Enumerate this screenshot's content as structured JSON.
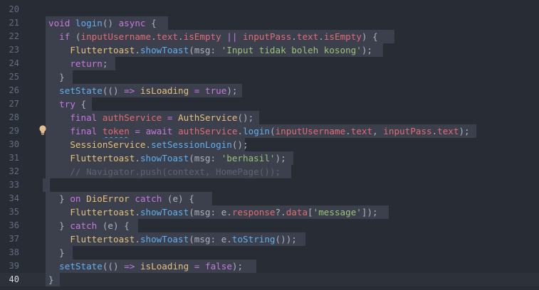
{
  "editor": {
    "current_line": "40",
    "lines": [
      {
        "n": "20",
        "tokens": []
      },
      {
        "n": "21",
        "tokens": [
          {
            "t": "void ",
            "c": "kw"
          },
          {
            "t": "login",
            "c": "fn"
          },
          {
            "t": "() ",
            "c": "pl"
          },
          {
            "t": "async",
            "c": "kw"
          },
          {
            "t": " {",
            "c": "pl"
          }
        ]
      },
      {
        "n": "22",
        "tokens": [
          {
            "t": "  ",
            "c": "pl"
          },
          {
            "t": "if",
            "c": "kw"
          },
          {
            "t": " (",
            "c": "pl"
          },
          {
            "t": "inputUsername",
            "c": "var"
          },
          {
            "t": ".",
            "c": "pl"
          },
          {
            "t": "text",
            "c": "var"
          },
          {
            "t": ".",
            "c": "pl"
          },
          {
            "t": "isEmpty",
            "c": "var"
          },
          {
            "t": " || ",
            "c": "kw"
          },
          {
            "t": "inputPass",
            "c": "var"
          },
          {
            "t": ".",
            "c": "pl"
          },
          {
            "t": "text",
            "c": "var"
          },
          {
            "t": ".",
            "c": "pl"
          },
          {
            "t": "isEmpty",
            "c": "var"
          },
          {
            "t": ") {",
            "c": "pl"
          }
        ]
      },
      {
        "n": "23",
        "tokens": [
          {
            "t": "    ",
            "c": "pl"
          },
          {
            "t": "Fluttertoast",
            "c": "cls"
          },
          {
            "t": ".",
            "c": "pl"
          },
          {
            "t": "showToast",
            "c": "fn"
          },
          {
            "t": "(msg: ",
            "c": "pl"
          },
          {
            "t": "'Input tidak boleh kosong'",
            "c": "str"
          },
          {
            "t": ");",
            "c": "pl"
          }
        ]
      },
      {
        "n": "24",
        "tokens": [
          {
            "t": "    ",
            "c": "pl"
          },
          {
            "t": "return",
            "c": "kw"
          },
          {
            "t": ";",
            "c": "pl"
          }
        ]
      },
      {
        "n": "25",
        "tokens": [
          {
            "t": "  }",
            "c": "pl"
          }
        ]
      },
      {
        "n": "26",
        "tokens": [
          {
            "t": "  ",
            "c": "pl"
          },
          {
            "t": "setState",
            "c": "fn"
          },
          {
            "t": "(() ",
            "c": "pl"
          },
          {
            "t": "=>",
            "c": "kw"
          },
          {
            "t": " ",
            "c": "pl"
          },
          {
            "t": "isLoading",
            "c": "cls"
          },
          {
            "t": " ",
            "c": "pl"
          },
          {
            "t": "=",
            "c": "kw"
          },
          {
            "t": " ",
            "c": "pl"
          },
          {
            "t": "true",
            "c": "kw"
          },
          {
            "t": ");",
            "c": "pl"
          }
        ]
      },
      {
        "n": "27",
        "tokens": [
          {
            "t": "  ",
            "c": "pl"
          },
          {
            "t": "try",
            "c": "kw"
          },
          {
            "t": " {",
            "c": "pl"
          }
        ]
      },
      {
        "n": "28",
        "tokens": [
          {
            "t": "    ",
            "c": "pl"
          },
          {
            "t": "final",
            "c": "kw"
          },
          {
            "t": " ",
            "c": "pl"
          },
          {
            "t": "authService",
            "c": "var"
          },
          {
            "t": " ",
            "c": "pl"
          },
          {
            "t": "=",
            "c": "kw"
          },
          {
            "t": " ",
            "c": "pl"
          },
          {
            "t": "AuthService",
            "c": "cls"
          },
          {
            "t": "();",
            "c": "pl"
          }
        ]
      },
      {
        "n": "29",
        "tokens": [
          {
            "t": "    ",
            "c": "pl"
          },
          {
            "t": "final",
            "c": "kw"
          },
          {
            "t": " ",
            "c": "pl"
          },
          {
            "t": "token",
            "c": "var",
            "sq": true
          },
          {
            "t": " ",
            "c": "pl"
          },
          {
            "t": "=",
            "c": "kw"
          },
          {
            "t": " ",
            "c": "pl"
          },
          {
            "t": "await",
            "c": "kw"
          },
          {
            "t": " ",
            "c": "pl"
          },
          {
            "t": "authService",
            "c": "var"
          },
          {
            "t": ".",
            "c": "pl"
          },
          {
            "t": "login",
            "c": "fn"
          },
          {
            "t": "(",
            "c": "pl"
          },
          {
            "t": "inputUsername",
            "c": "var"
          },
          {
            "t": ".",
            "c": "pl"
          },
          {
            "t": "text",
            "c": "var"
          },
          {
            "t": ", ",
            "c": "pl"
          },
          {
            "t": "inputPass",
            "c": "var"
          },
          {
            "t": ".",
            "c": "pl"
          },
          {
            "t": "text",
            "c": "var"
          },
          {
            "t": ");",
            "c": "pl"
          }
        ]
      },
      {
        "n": "30",
        "tokens": [
          {
            "t": "    ",
            "c": "pl"
          },
          {
            "t": "SessionService",
            "c": "cls"
          },
          {
            "t": ".",
            "c": "pl"
          },
          {
            "t": "setSessionLogin",
            "c": "fn"
          },
          {
            "t": "();",
            "c": "pl"
          }
        ]
      },
      {
        "n": "31",
        "tokens": [
          {
            "t": "    ",
            "c": "pl"
          },
          {
            "t": "Fluttertoast",
            "c": "cls"
          },
          {
            "t": ".",
            "c": "pl"
          },
          {
            "t": "showToast",
            "c": "fn"
          },
          {
            "t": "(msg: ",
            "c": "pl"
          },
          {
            "t": "'berhasil'",
            "c": "str"
          },
          {
            "t": ");",
            "c": "pl"
          }
        ]
      },
      {
        "n": "32",
        "tokens": [
          {
            "t": "    ",
            "c": "pl"
          },
          {
            "t": "// Navigator.push(context, HomePage());",
            "c": "cmt"
          }
        ]
      },
      {
        "n": "33",
        "tokens": []
      },
      {
        "n": "34",
        "tokens": [
          {
            "t": "  } ",
            "c": "pl"
          },
          {
            "t": "on",
            "c": "kw"
          },
          {
            "t": " ",
            "c": "pl"
          },
          {
            "t": "DioError",
            "c": "cls"
          },
          {
            "t": " ",
            "c": "pl"
          },
          {
            "t": "catch",
            "c": "kw"
          },
          {
            "t": " (e) {",
            "c": "pl"
          }
        ]
      },
      {
        "n": "35",
        "tokens": [
          {
            "t": "    ",
            "c": "pl"
          },
          {
            "t": "Fluttertoast",
            "c": "cls"
          },
          {
            "t": ".",
            "c": "pl"
          },
          {
            "t": "showToast",
            "c": "fn"
          },
          {
            "t": "(msg: e.",
            "c": "pl"
          },
          {
            "t": "response",
            "c": "var"
          },
          {
            "t": "?.",
            "c": "pl"
          },
          {
            "t": "data",
            "c": "var"
          },
          {
            "t": "[",
            "c": "pl"
          },
          {
            "t": "'message'",
            "c": "str"
          },
          {
            "t": "]);",
            "c": "pl"
          }
        ]
      },
      {
        "n": "36",
        "tokens": [
          {
            "t": "  } ",
            "c": "pl"
          },
          {
            "t": "catch",
            "c": "kw"
          },
          {
            "t": " (e) {",
            "c": "pl"
          }
        ]
      },
      {
        "n": "37",
        "tokens": [
          {
            "t": "    ",
            "c": "pl"
          },
          {
            "t": "Fluttertoast",
            "c": "cls"
          },
          {
            "t": ".",
            "c": "pl"
          },
          {
            "t": "showToast",
            "c": "fn"
          },
          {
            "t": "(msg: e.",
            "c": "pl"
          },
          {
            "t": "toString",
            "c": "fn"
          },
          {
            "t": "());",
            "c": "pl"
          }
        ]
      },
      {
        "n": "38",
        "tokens": [
          {
            "t": "  }",
            "c": "pl"
          }
        ]
      },
      {
        "n": "39",
        "tokens": [
          {
            "t": "  ",
            "c": "pl"
          },
          {
            "t": "setState",
            "c": "fn"
          },
          {
            "t": "(() ",
            "c": "pl"
          },
          {
            "t": "=>",
            "c": "kw"
          },
          {
            "t": " ",
            "c": "pl"
          },
          {
            "t": "isLoading",
            "c": "cls"
          },
          {
            "t": " ",
            "c": "pl"
          },
          {
            "t": "=",
            "c": "kw"
          },
          {
            "t": " ",
            "c": "pl"
          },
          {
            "t": "false",
            "c": "kw"
          },
          {
            "t": ");",
            "c": "pl"
          }
        ]
      },
      {
        "n": "40",
        "tokens": [
          {
            "t": "}",
            "c": "pl"
          }
        ]
      }
    ],
    "lightbulb_icon": "lightbulb-icon",
    "colors": {
      "background": "#282c34",
      "selection": "#3e4451",
      "keyword": "#c678dd",
      "function": "#61afef",
      "class": "#e5c07b",
      "variable": "#e06c75",
      "string": "#98c379",
      "comment": "#5c6370"
    }
  }
}
